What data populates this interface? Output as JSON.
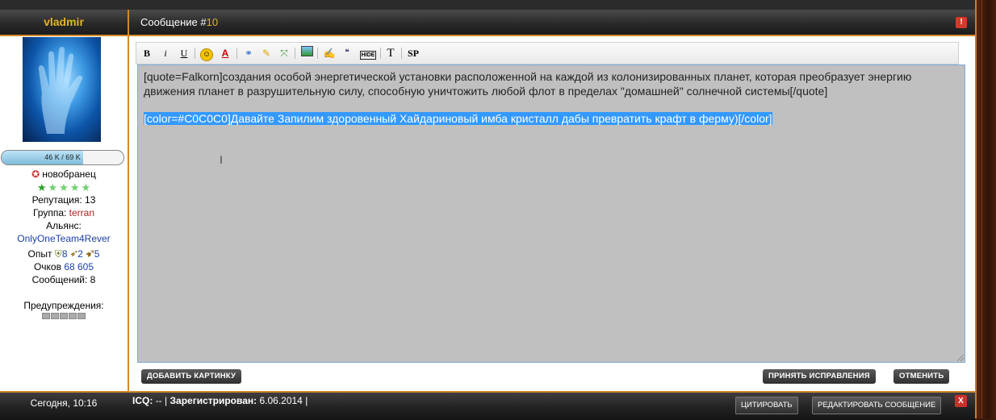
{
  "profile": {
    "username": "vladmir",
    "xp_text": "46 K / 69 K",
    "xp_fraction": 0.667,
    "rank": "новобранец",
    "stars_total": 5,
    "stars_filled": 1,
    "reputation_label": "Репутация:",
    "reputation_value": "13",
    "group_label": "Группа:",
    "group_value": "terran",
    "alliance_label": "Альянс:",
    "alliance_value": "OnlyOneTeam4Rever",
    "exp_label": "Опыт",
    "exp_values": [
      "8",
      "2",
      "5"
    ],
    "points_label": "Очков",
    "points_value": "68 605",
    "messages_label": "Сообщений:",
    "messages_value": "8",
    "warnings_label": "Предупреждения:"
  },
  "message": {
    "title_prefix": "Сообщение #",
    "number": "10",
    "alert_icon": "!"
  },
  "toolbar": {
    "bold": "B",
    "italic": "i",
    "underline": "U",
    "text": "T",
    "spoiler": "SP",
    "hide": "HIDE"
  },
  "editor": {
    "quote_text": "[quote=Falkorn]создания особой энергетической установки расположенной на каждой из колонизированных планет, которая преобразует энергию движения планет в разрушительную силу, способную уничтожить любой флот в пределах \"домашней\" солнечной системы[/quote]",
    "selected_text": "[color=#C0C0C0]Давайте Запилим здоровенный Хайдариновый имба кристалл дабы превратить крафт в ферму)[/color]",
    "background": "#c0c0c0",
    "selection_color": "#3399ff"
  },
  "buttons": {
    "add_picture": "ДОБАВИТЬ КАРТИНКУ",
    "accept": "ПРИНЯТЬ ИСПРАВЛЕНИЯ",
    "cancel": "ОТМЕНИТЬ"
  },
  "footer": {
    "date": "Сегодня, 10:16",
    "icq_label": "ICQ:",
    "icq_value": "--",
    "registered_label": "Зарегистрирован:",
    "registered_value": "6.06.2014",
    "sep": "|",
    "quote_button": "ЦИТИРОВАТЬ",
    "edit_button": "РЕДАКТИРОВАТЬ СООБЩЕНИЕ",
    "close_icon": "X"
  },
  "colors": {
    "accent": "#d28a2a",
    "username": "#e0b62a",
    "bar_dark": "#2a2a2a"
  }
}
